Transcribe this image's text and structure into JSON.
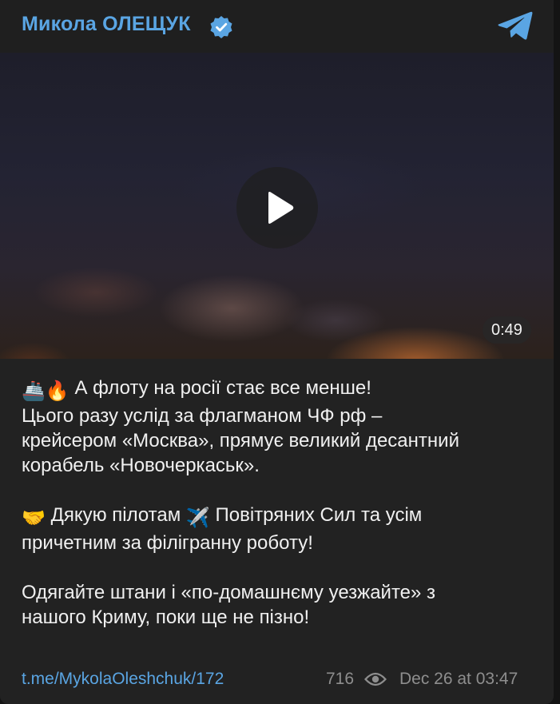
{
  "channel": {
    "name": "Микола ОЛЕЩУК",
    "verified": true,
    "accent_color": "#5aa5e3"
  },
  "video": {
    "duration": "0:49",
    "play_icon": "play-icon"
  },
  "post": {
    "paragraphs": [
      {
        "emojis": [
          "🚢",
          "🔥"
        ],
        "lines": [
          "А флоту на росії стає все менше!",
          "Цього разу услід за флагманом ЧФ рф –",
          "крейсером «Москва», прямує великий десантний",
          "корабель «Новочеркаськ»."
        ]
      },
      {
        "emoji_start": "🤝",
        "text_a": "Дякую пілотам",
        "emoji_mid": "✈️",
        "text_b": "Повітряних Сил та усім",
        "line2": "причетним за філігранну роботу!"
      },
      {
        "lines": [
          "Одягайте штани і «по-домашнєму уезжайте» з",
          "нашого Криму, поки ще не пізно!"
        ]
      }
    ]
  },
  "footer": {
    "link": "t.me/MykolaOleshchuk/172",
    "views": "716",
    "date": "Dec 26 at 03:47"
  }
}
